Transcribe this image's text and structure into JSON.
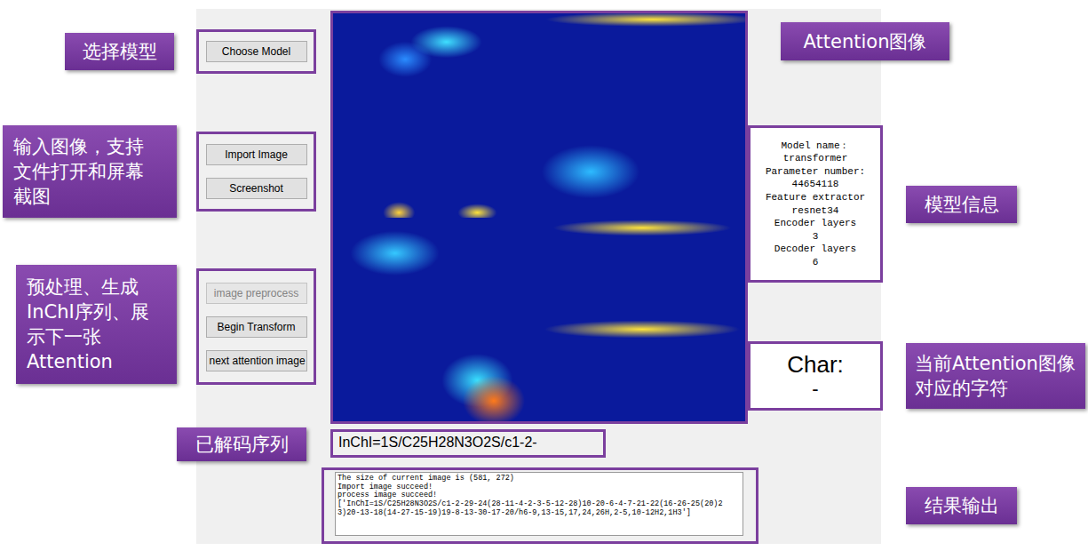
{
  "callouts": [
    {
      "text": "选择模型"
    },
    {
      "text": "输入图像，支持文件打开和屏幕截图"
    },
    {
      "text": "预处理、生成InChI序列、展示下一张Attention"
    },
    {
      "text": "已解码序列"
    },
    {
      "text": "Attention图像"
    },
    {
      "text": "模型信息"
    },
    {
      "text": "当前Attention图像对应的字符"
    },
    {
      "text": "结果输出"
    }
  ],
  "model_button": {
    "label": "Choose Model",
    "disabled": false
  },
  "input_buttons": [
    {
      "label": "Import Image",
      "disabled": false
    },
    {
      "label": "Screenshot",
      "disabled": false
    }
  ],
  "action_buttons": [
    {
      "label": "image preprocess",
      "disabled": true
    },
    {
      "label": "Begin Transform",
      "disabled": false
    },
    {
      "label": "next attention image",
      "disabled": false
    }
  ],
  "model_info": [
    "Model name：",
    "transformer",
    "Parameter number:",
    "44654118",
    "Feature extractor",
    "resnet34",
    "Encoder layers",
    "3",
    "Decoder layers",
    "6"
  ],
  "char": {
    "label": "Char:",
    "value": "-"
  },
  "decoded": "InChI=1S/C25H28N3O2S/c1-2-",
  "output_lines": [
    "The size of current image is (581, 272)",
    "Import image succeed!",
    "process image succeed!",
    "['InChI=1S/C25H28N3O2S/c1-2-29-24(28-11-4-2-3-5-12-28)10-20-6-4-7-21-22(16-26-25(20)2",
    "3)20-13-18(14-27-15-19)19-8-13-30-17-20/h6-9,13-15,17,24,26H,2-5,10-12H2,1H3']"
  ]
}
